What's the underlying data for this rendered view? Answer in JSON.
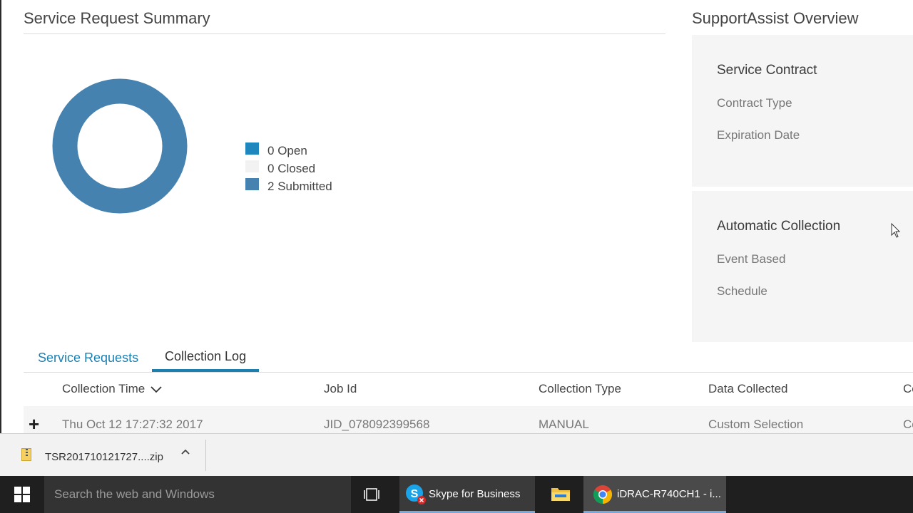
{
  "summary": {
    "title": "Service Request Summary",
    "legend": [
      {
        "count": "0",
        "label": "Open",
        "color": "#1e88be"
      },
      {
        "count": "0",
        "label": "Closed",
        "color": "#f2f2f2"
      },
      {
        "count": "2",
        "label": "Submitted",
        "color": "#4682b0"
      }
    ]
  },
  "chart_data": {
    "type": "pie",
    "categories": [
      "Open",
      "Closed",
      "Submitted"
    ],
    "values": [
      0,
      0,
      2
    ],
    "title": ""
  },
  "overview": {
    "title": "SupportAssist Overview",
    "service_contract": {
      "title": "Service Contract",
      "items": [
        "Contract Type",
        "Expiration Date"
      ]
    },
    "automatic_collection": {
      "title": "Automatic Collection",
      "items": [
        "Event Based",
        "Schedule"
      ]
    }
  },
  "tabs": [
    {
      "label": "Service Requests",
      "active": false
    },
    {
      "label": "Collection Log",
      "active": true
    }
  ],
  "table": {
    "columns": [
      "Collection Time",
      "Job Id",
      "Collection Type",
      "Data Collected",
      "Co"
    ],
    "rows": [
      [
        "Thu Oct 12 17:27:32 2017",
        "JID_078092399568",
        "MANUAL",
        "Custom Selection",
        "Co"
      ]
    ]
  },
  "download": {
    "filename": "TSR201710121727....zip"
  },
  "taskbar": {
    "search_placeholder": "Search the web and Windows",
    "apps": [
      "Skype for Business",
      "iDRAC-R740CH1 - i..."
    ]
  },
  "icons": [
    "windows-start-icon",
    "task-view-icon",
    "skype-icon",
    "file-explorer-icon",
    "chrome-icon",
    "zip-file-icon",
    "chevron-up-icon",
    "chevron-down-icon",
    "expand-plus-icon",
    "mouse-cursor-icon"
  ]
}
